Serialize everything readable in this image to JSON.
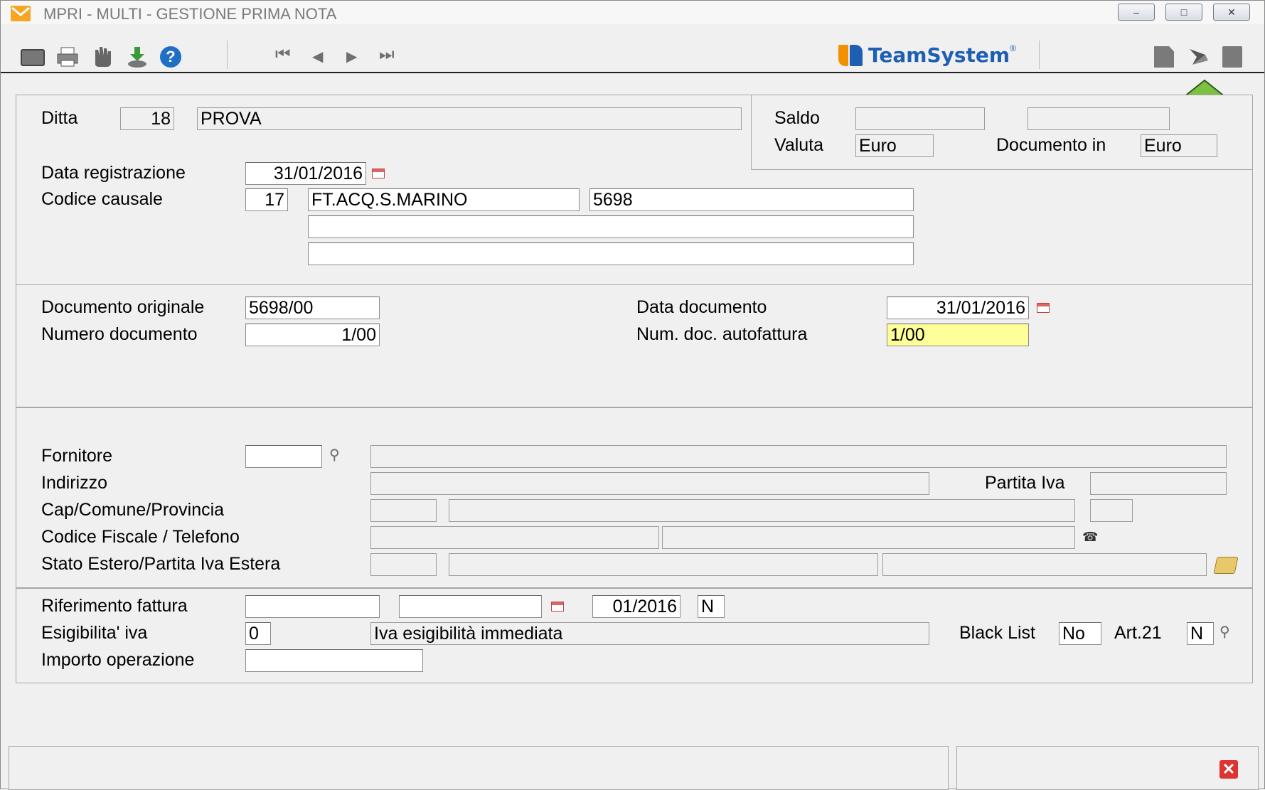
{
  "window": {
    "title": "MPRI  - MULTI -  GESTIONE PRIMA NOTA",
    "minimize": "–",
    "restore": "□",
    "close": "✕"
  },
  "toolbar": {
    "nav_first": "⏮",
    "nav_prev": "◀",
    "nav_next": "▶",
    "nav_last": "⏭",
    "brand": "TeamSystem",
    "brand_reg": "®"
  },
  "header": {
    "ditta_label": "Ditta",
    "ditta_code": "18",
    "ditta_name": "PROVA",
    "saldo_label": "Saldo",
    "saldo_value": "",
    "saldo_value2": "",
    "valuta_label": "Valuta",
    "valuta_value": "Euro",
    "documento_in_label": "Documento in",
    "documento_in_value": "Euro",
    "data_reg_label": "Data registrazione",
    "data_reg_value": "31/01/2016",
    "causale_label": "Codice causale",
    "causale_code": "17",
    "causale_desc": "FT.ACQ.S.MARINO",
    "causale_extra": "5698",
    "note1": "",
    "note2": ""
  },
  "documento": {
    "orig_label": "Documento originale",
    "orig_value": "5698/00",
    "num_label": "Numero documento",
    "num_value": "1/00",
    "data_label": "Data documento",
    "data_value": "31/01/2016",
    "autofatt_label": "Num. doc. autofattura",
    "autofatt_value": "1/00"
  },
  "fornitore": {
    "fornitore_label": "Fornitore",
    "indirizzo_label": "Indirizzo",
    "partita_iva_label": "Partita Iva",
    "cap_label": "Cap/Comune/Provincia",
    "cf_label": "Codice Fiscale / Telefono",
    "estero_label": "Stato Estero/Partita Iva Estera"
  },
  "riferimento": {
    "rif_label": "Riferimento fattura",
    "rif_period": "01/2016",
    "rif_flag": "N",
    "esig_label": "Esigibilita' iva",
    "esig_code": "0",
    "esig_desc": "Iva esigibilità immediata",
    "blacklist_label": "Black List",
    "blacklist_value": "No",
    "art21_label": "Art.21",
    "art21_value": "N",
    "importo_label": "Importo operazione",
    "importo_value": ""
  },
  "colors": {
    "accent_arrow": "#7dc142",
    "highlight_field": "#ffff99",
    "brand_blue": "#1e5fb4",
    "brand_orange": "#f29100"
  }
}
